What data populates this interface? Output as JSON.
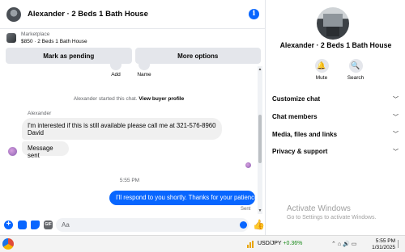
{
  "chat": {
    "header_title": "Alexander · 2 Beds 1 Bath House",
    "listing": {
      "label": "Marketplace",
      "detail": "$850 · 2 Beds 1 Bath House"
    },
    "actions": {
      "pending": "Mark as pending",
      "more": "More options"
    },
    "quick": {
      "add": "Add",
      "name": "Name"
    },
    "system": {
      "text": "Alexander started this chat.",
      "link": "View buyer profile"
    },
    "sender_name": "Alexander",
    "messages_in": [
      {
        "line1": "I'm interested if this is still available please call me at 321-576-8960",
        "line2": "David"
      },
      {
        "line1": "Message sent"
      }
    ],
    "timestamp": "5:55 PM",
    "message_out": "I'll respond to you shortly. Thanks for your patience",
    "sent_label": "Sent",
    "composer_placeholder": "Aa"
  },
  "details": {
    "title": "Alexander · 2 Beds 1 Bath House",
    "mute": "Mute",
    "search": "Search",
    "sections": [
      "Customize chat",
      "Chat members",
      "Media, files and links",
      "Privacy & support"
    ]
  },
  "watermark": {
    "line1": "Activate Windows",
    "line2": "Go to Settings to activate Windows."
  },
  "taskbar": {
    "ticker": "USD/JPY",
    "change": "+0.36%",
    "time": "5:55 PM",
    "date": "1/31/2025"
  },
  "colors": {
    "accent": "#0866ff",
    "bubble_in": "#f0f0f0",
    "positive": "#1a8a1a"
  }
}
